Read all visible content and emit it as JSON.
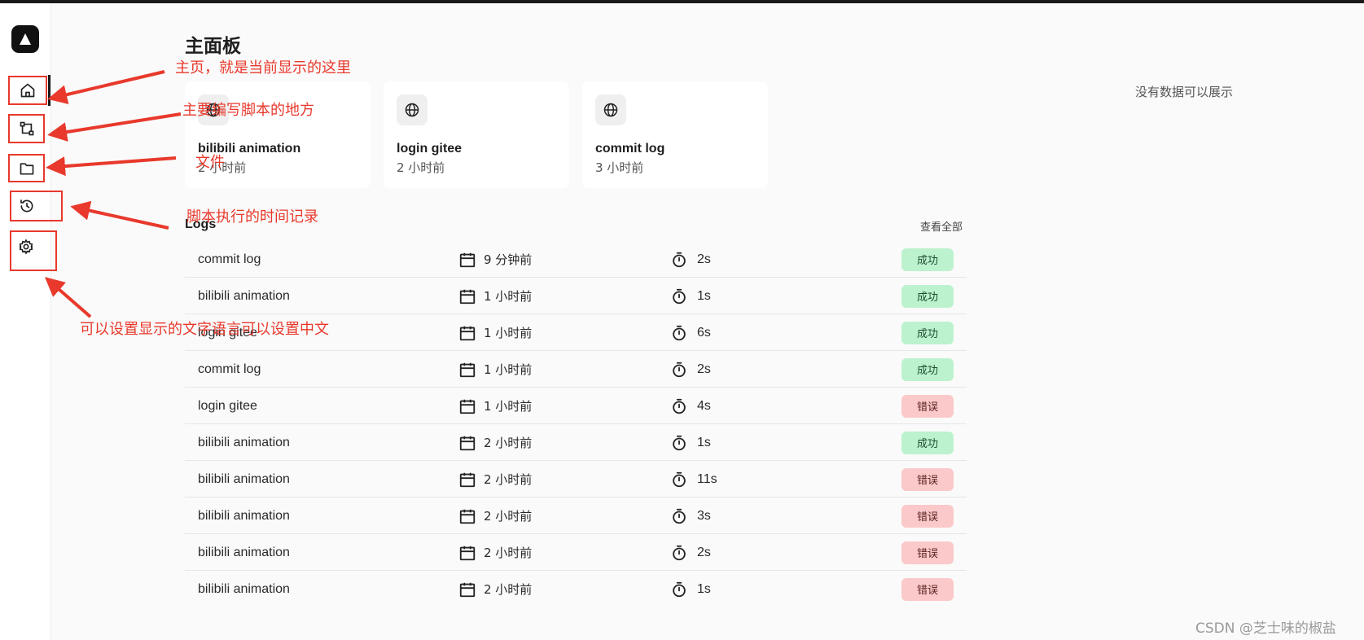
{
  "page_title": "主面板",
  "sidebar": {
    "items": [
      {
        "name": "home",
        "icon": "home-icon"
      },
      {
        "name": "scripts",
        "icon": "flow-icon"
      },
      {
        "name": "files",
        "icon": "folder-icon"
      },
      {
        "name": "history",
        "icon": "history-icon"
      },
      {
        "name": "settings",
        "icon": "gear-icon"
      }
    ]
  },
  "recent": [
    {
      "name": "bilibili animation",
      "time": "2 小时前",
      "icon": "globe-icon"
    },
    {
      "name": "login gitee",
      "time": "2 小时前",
      "icon": "globe-icon"
    },
    {
      "name": "commit log",
      "time": "3 小时前",
      "icon": "globe-icon"
    }
  ],
  "chart_empty_text": "没有数据可以展示",
  "logs": {
    "title": "Logs",
    "view_all": "查看全部",
    "rows": [
      {
        "name": "commit log",
        "time": "9 分钟前",
        "duration": "2s",
        "status": "成功",
        "status_type": "success"
      },
      {
        "name": "bilibili animation",
        "time": "1 小时前",
        "duration": "1s",
        "status": "成功",
        "status_type": "success"
      },
      {
        "name": "login gitee",
        "time": "1 小时前",
        "duration": "6s",
        "status": "成功",
        "status_type": "success"
      },
      {
        "name": "commit log",
        "time": "1 小时前",
        "duration": "2s",
        "status": "成功",
        "status_type": "success"
      },
      {
        "name": "login gitee",
        "time": "1 小时前",
        "duration": "4s",
        "status": "错误",
        "status_type": "error"
      },
      {
        "name": "bilibili animation",
        "time": "2 小时前",
        "duration": "1s",
        "status": "成功",
        "status_type": "success"
      },
      {
        "name": "bilibili animation",
        "time": "2 小时前",
        "duration": "11s",
        "status": "错误",
        "status_type": "error"
      },
      {
        "name": "bilibili animation",
        "time": "2 小时前",
        "duration": "3s",
        "status": "错误",
        "status_type": "error"
      },
      {
        "name": "bilibili animation",
        "time": "2 小时前",
        "duration": "2s",
        "status": "错误",
        "status_type": "error"
      },
      {
        "name": "bilibili animation",
        "time": "2 小时前",
        "duration": "1s",
        "status": "错误",
        "status_type": "error"
      }
    ]
  },
  "annotations": {
    "home": "主页，就是当前显示的这里",
    "scripts": "主要编写脚本的地方",
    "files": "文件",
    "history": "脚本执行的时间记录",
    "settings": "可以设置显示的文字语言可以设置中文"
  },
  "watermark": "CSDN @芝士味的椒盐",
  "colors": {
    "annotation": "#e8392c",
    "success_bg": "#bdf2cf",
    "error_bg": "#fbc9c9"
  }
}
